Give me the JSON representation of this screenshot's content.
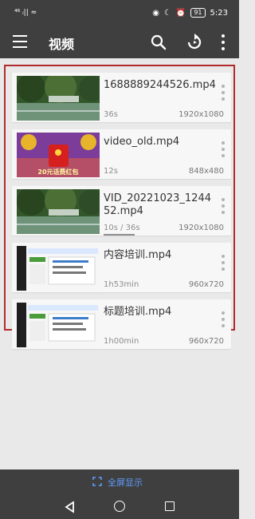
{
  "status": {
    "carrier": "⁴⁶ ᵢ|| ≈",
    "battery": "91",
    "time": "5:23"
  },
  "app": {
    "title": "视频"
  },
  "videos": [
    {
      "name": "1688889244526.mp4",
      "duration": "36s",
      "resolution": "1920x1080",
      "thumb": "garden"
    },
    {
      "name": "video_old.mp4",
      "duration": "12s",
      "resolution": "848x480",
      "thumb": "promo",
      "thumb_text": "20元话费红包"
    },
    {
      "name": "VID_20221023_1244 52.mp4",
      "duration": "10s / 36s",
      "resolution": "1920x1080",
      "thumb": "garden",
      "progress": 0.28
    },
    {
      "name": "内容培训.mp4",
      "duration": "1h53min",
      "resolution": "960x720",
      "thumb": "screen"
    },
    {
      "name": "标题培训.mp4",
      "duration": "1h00min",
      "resolution": "960x720",
      "thumb": "screen"
    }
  ],
  "footer": {
    "fullscreen_label": "全屏显示"
  },
  "colors": {
    "bar": "#3f3f3f",
    "accent": "#5f9dff",
    "frame": "#b22b2b"
  }
}
